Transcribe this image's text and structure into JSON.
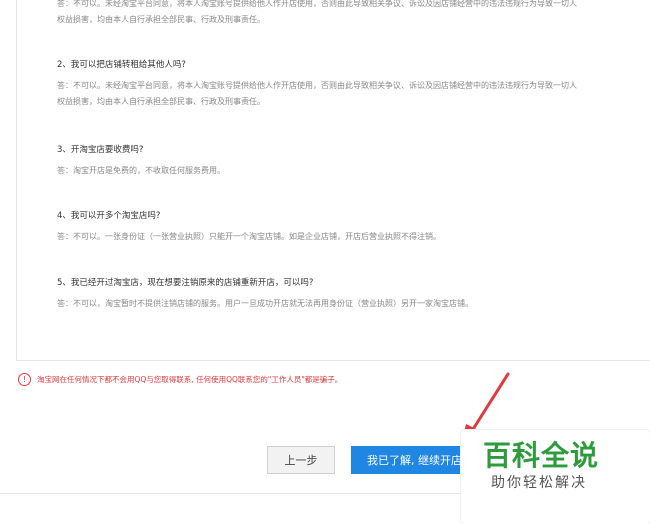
{
  "faq": [
    {
      "question": "",
      "answer": "答：不可以。未经淘宝平台同意，将本人淘宝账号提供给他人作开店使用，否则由此导致相关争议、诉讼及因店铺经营中的违法违规行为导致一切人\n权益损害，均由本人自行承担全部民事、行政及刑事责任。"
    },
    {
      "question": "2、我可以把店铺转租给其他人吗?",
      "answer": "答：不可以。未经淘宝平台同意，将本人淘宝账号提供给他人作开店使用，否则由此导致相关争议、诉讼及因店铺经营中的违法违规行为导致一切人\n权益损害，均由本人自行承担全部民事、行政及刑事责任。"
    },
    {
      "question": "3、开淘宝店要收费吗?",
      "answer": "答：淘宝开店是免费的，不收取任何服务费用。"
    },
    {
      "question": "4、我可以开多个淘宝店吗?",
      "answer": "答：不可以。一张身份证（一张营业执照）只能开一个淘宝店铺。如是企业店铺，开店后营业执照不得注销。"
    },
    {
      "question": "5、我已经开过淘宝店，现在想要注销原来的店铺重新开店，可以吗?",
      "answer": "答：不可以，淘宝暂时不提供注销店铺的服务。用户一旦成功开店就无法再用身份证（营业执照）另开一家淘宝店铺。"
    }
  ],
  "warning": {
    "icon": "!",
    "text": "淘宝网在任何情况下都不会用QQ与您取得联系, 任何使用QQ联系您的\"工作人员\"都是骗子。"
  },
  "buttons": {
    "prev": "上一步",
    "next": "我已了解, 继续开店"
  },
  "watermark": {
    "title": "百科全说",
    "subtitle": "助你轻松解决"
  },
  "colors": {
    "primary": "#1f86e3",
    "warning": "#e4393c",
    "watermark_green": "#2e9b3c"
  }
}
